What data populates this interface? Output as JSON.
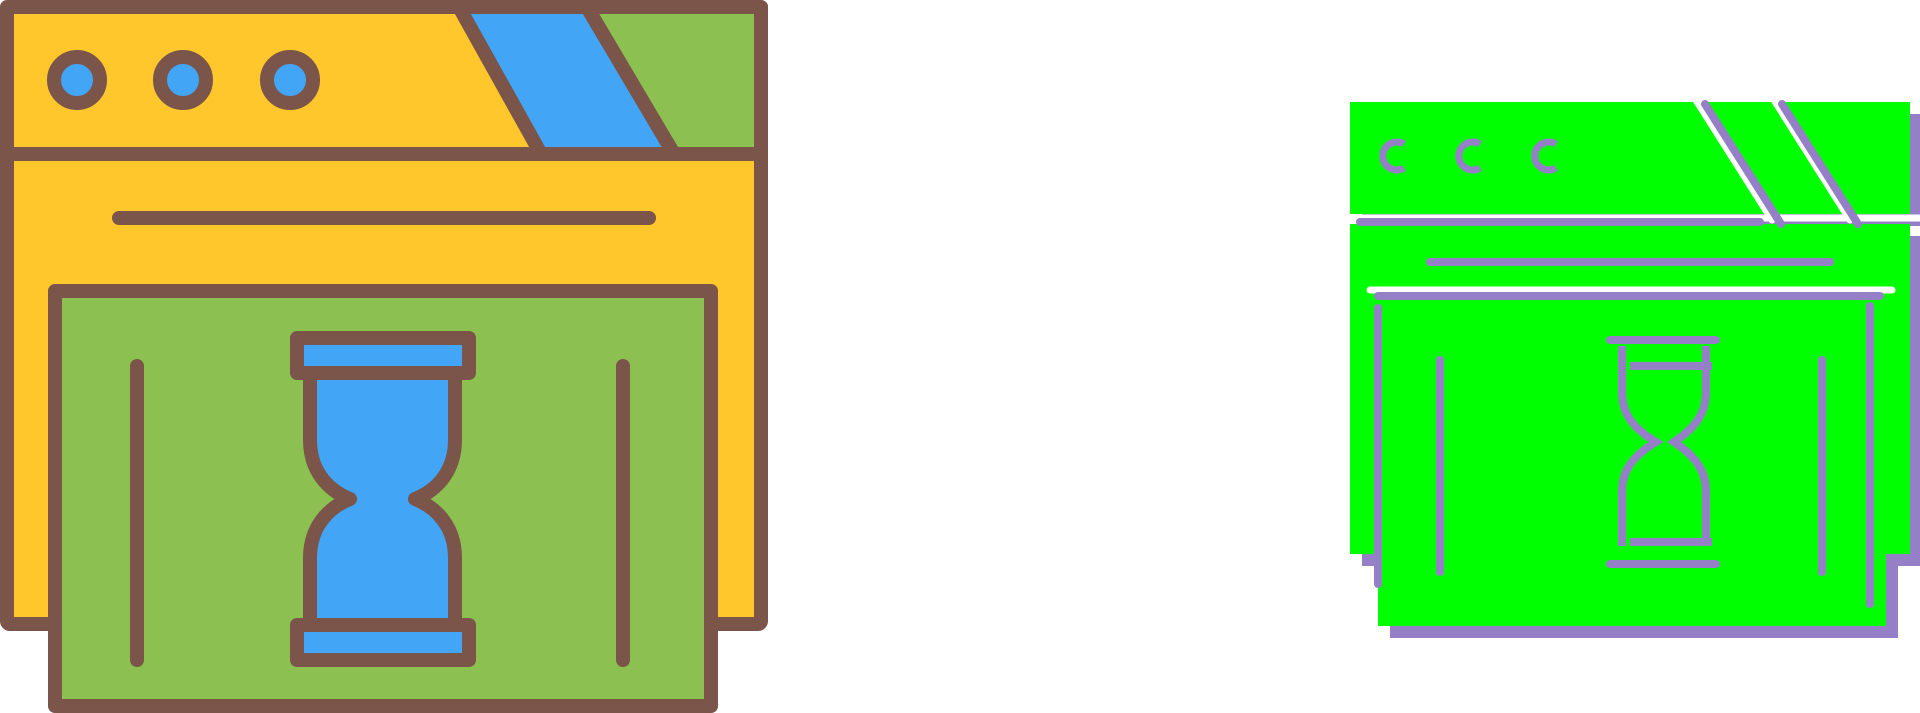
{
  "icons": [
    {
      "name": "browser-loading-icon",
      "style": "filled-line",
      "colors": {
        "frame": "#FFC72C",
        "panel": "#8CC152",
        "accent": "#42A5F5",
        "outline": "#7B5549"
      }
    },
    {
      "name": "browser-loading-icon",
      "style": "glyph",
      "colors": {
        "fill": "#00FF00",
        "shadow": "#9580C8",
        "outline": "#ffffff"
      }
    }
  ]
}
